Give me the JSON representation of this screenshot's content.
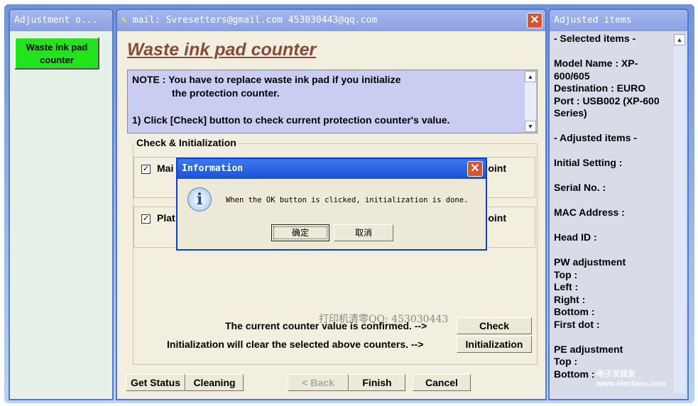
{
  "left": {
    "title": "Adjustment o...",
    "item": "Waste ink pad counter"
  },
  "main": {
    "title": "mail: Svresetters@gmail.com  453030443@qq.com",
    "heading": "Waste ink pad counter",
    "note": [
      "NOTE : You have to replace waste ink pad if you initialize",
      "the protection counter.",
      "",
      "1) Click [Check] button to check current protection counter's value."
    ],
    "group_label": "Check & Initialization",
    "rows": [
      {
        "label": "Mai",
        "checked": true,
        "right": "oint"
      },
      {
        "label": "Plat",
        "checked": true,
        "right": "oint"
      }
    ],
    "watermark": "打印机清零QQ: 453030443",
    "confirm_text": "The current counter value is confirmed. -->",
    "check": "Check",
    "init_text": "Initialization will clear the selected above counters. -->",
    "initialization": "Initialization",
    "buttons": {
      "get_status": "Get Status",
      "cleaning": "Cleaning",
      "back": "< Back",
      "finish": "Finish",
      "cancel": "Cancel"
    }
  },
  "right": {
    "title": "Adjusted items",
    "lines": [
      "- Selected items -",
      "",
      "Model Name : XP-",
      "600/605",
      "Destination : EURO",
      "Port : USB002 (XP-600",
      "Series)",
      "",
      "- Adjusted items -",
      "",
      "Initial Setting :",
      "",
      "Serial No. :",
      "",
      "MAC Address :",
      "",
      "Head ID :",
      "",
      "PW adjustment",
      "Top :",
      "Left :",
      "Right :",
      "Bottom :",
      "First dot :",
      "",
      "PE adjustment",
      "Top :",
      "Bottom :"
    ]
  },
  "dialog": {
    "title": "Information",
    "message": "When the OK button is clicked, initialization is done.",
    "ok": "确定",
    "cancel": "取消",
    "icon": "info-icon"
  },
  "logo": "电子发烧友 www.elecfans.com"
}
